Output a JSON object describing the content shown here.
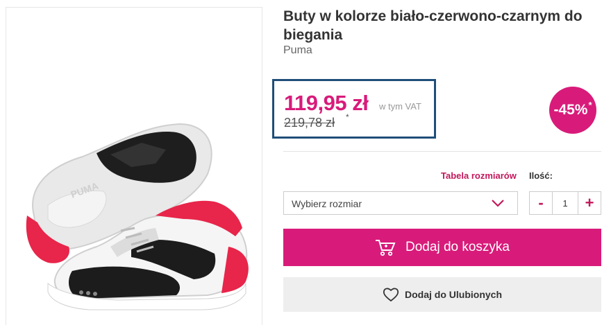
{
  "product": {
    "title": "Buty w kolorze biało-czerwono-czarnym do biegania",
    "brand": "Puma",
    "image_alt": "sneaker-product-image"
  },
  "price": {
    "current": "119,95 zł",
    "vat_note": "w tym VAT",
    "old": "219,78 zł",
    "old_star": "*"
  },
  "discount": {
    "value": "-45%",
    "star": "*"
  },
  "size": {
    "chart_link": "Tabela rozmiarów",
    "placeholder": "Wybierz rozmiar"
  },
  "quantity": {
    "label": "Ilość:",
    "minus": "-",
    "value": "1",
    "plus": "+"
  },
  "actions": {
    "add_to_cart": "Dodaj do koszyka",
    "add_to_favorites": "Dodaj do Ulubionych"
  },
  "colors": {
    "accent": "#d81b7a",
    "price_box_border": "#1f4e79"
  },
  "icons": {
    "cart": "cart-icon",
    "heart": "heart-icon",
    "dropdown": "chevron-down-icon"
  }
}
